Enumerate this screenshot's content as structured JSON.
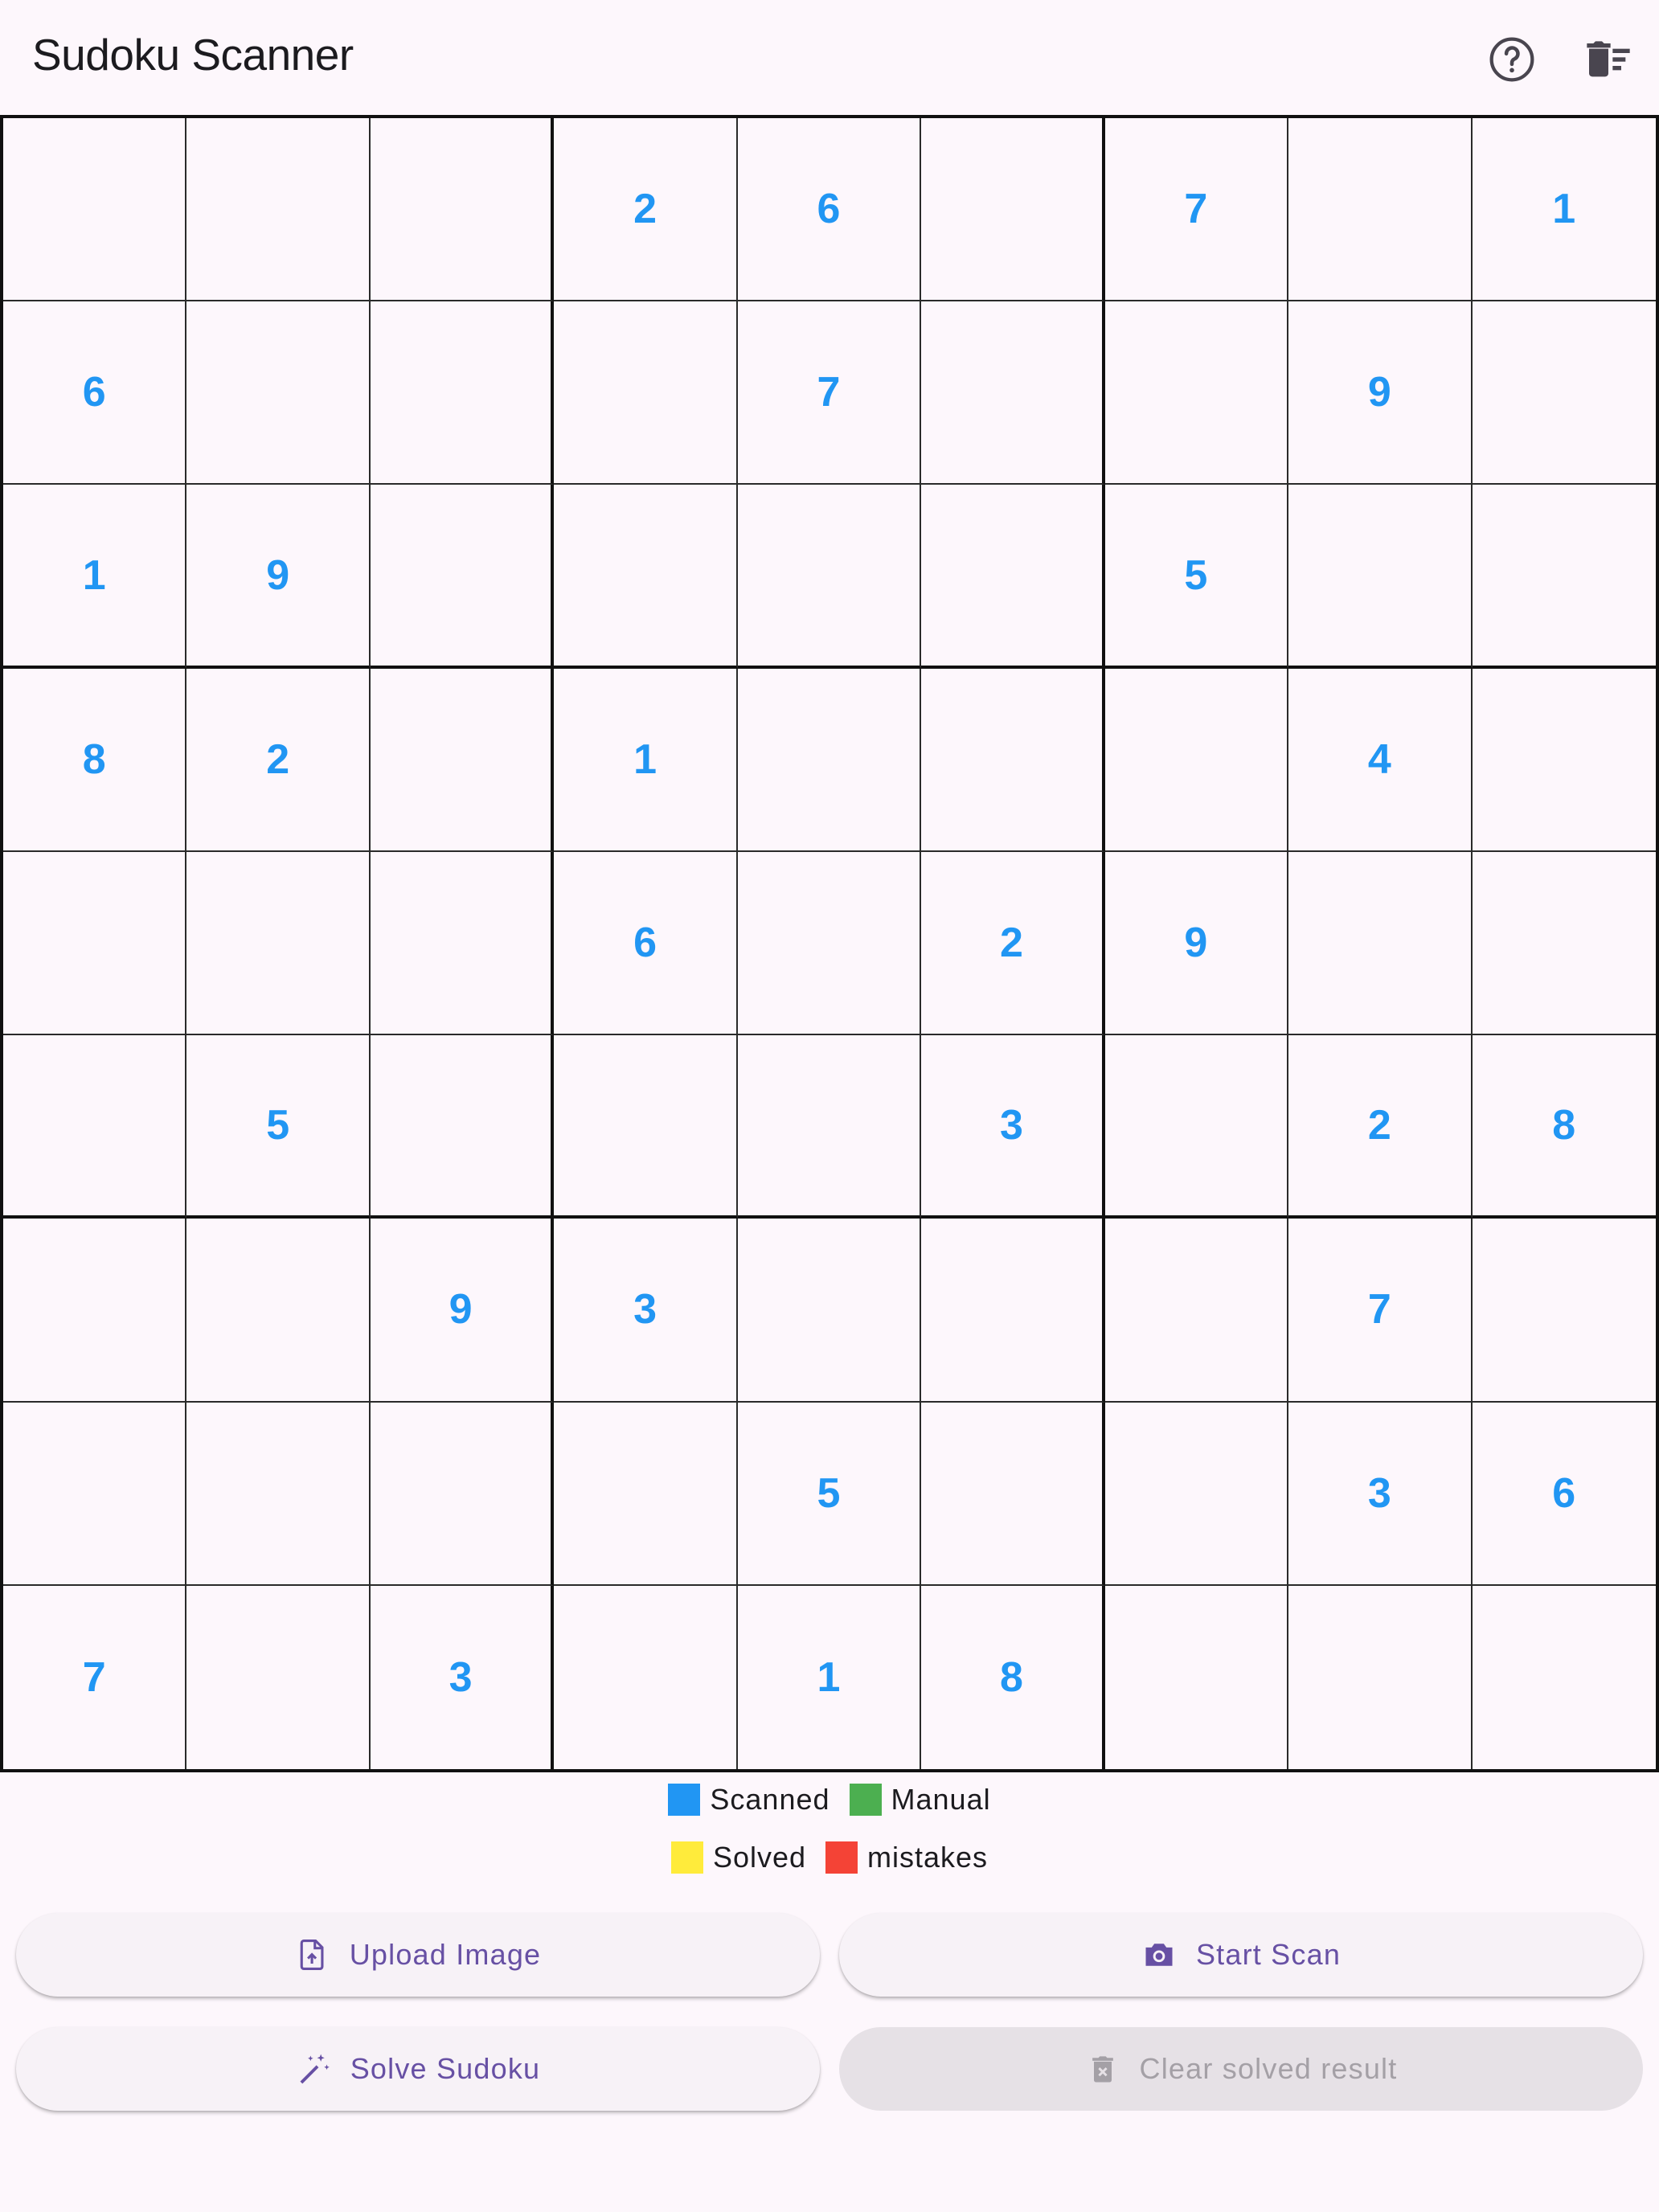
{
  "app": {
    "title": "Sudoku Scanner",
    "help_icon": "help-circle-icon",
    "clear_icon": "delete-sweep-icon"
  },
  "grid": {
    "rows": [
      [
        "",
        "",
        "",
        "2",
        "6",
        "",
        "7",
        "",
        "1"
      ],
      [
        "6",
        "",
        "",
        "",
        "7",
        "",
        "",
        "9",
        ""
      ],
      [
        "1",
        "9",
        "",
        "",
        "",
        "",
        "5",
        "",
        ""
      ],
      [
        "8",
        "2",
        "",
        "1",
        "",
        "",
        "",
        "4",
        ""
      ],
      [
        "",
        "",
        "",
        "6",
        "",
        "2",
        "9",
        "",
        ""
      ],
      [
        "",
        "5",
        "",
        "",
        "",
        "3",
        "",
        "2",
        "8"
      ],
      [
        "",
        "",
        "9",
        "3",
        "",
        "",
        "",
        "7",
        ""
      ],
      [
        "",
        "",
        "",
        "",
        "5",
        "",
        "",
        "3",
        "6"
      ],
      [
        "7",
        "",
        "3",
        "",
        "1",
        "8",
        "",
        "",
        ""
      ]
    ],
    "digit_color": "#2196f3"
  },
  "legend": [
    {
      "label": "Scanned",
      "color": "#2196f3"
    },
    {
      "label": "Manual",
      "color": "#4caf50"
    },
    {
      "label": "Solved",
      "color": "#ffeb3b"
    },
    {
      "label": "mistakes",
      "color": "#f44336"
    }
  ],
  "buttons": {
    "upload": {
      "label": "Upload Image",
      "icon": "file-upload-icon"
    },
    "scan": {
      "label": "Start Scan",
      "icon": "camera-icon"
    },
    "solve": {
      "label": "Solve Sudoku",
      "icon": "magic-wand-icon"
    },
    "clear": {
      "label": "Clear solved result",
      "icon": "trash-icon",
      "disabled": true
    }
  },
  "colors": {
    "background": "#fdf7fc",
    "accent": "#6750a4"
  }
}
